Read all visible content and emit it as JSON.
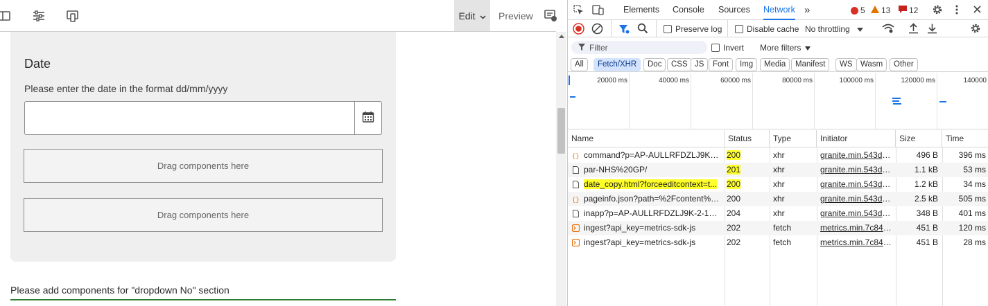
{
  "editor": {
    "toolbar": {
      "edit_label": "Edit",
      "preview_label": "Preview",
      "icons": [
        "sidebar-toggle-icon",
        "properties-icon",
        "emulator-icon",
        "annotations-panel-icon"
      ]
    },
    "date_component": {
      "title": "Date",
      "help_text": "Please enter the date in the format dd/mm/yyyy",
      "value": ""
    },
    "dropzones": [
      "Drag components here",
      "Drag components here"
    ],
    "section_note": "Please add components for \"dropdown No\" section"
  },
  "devtools": {
    "tabs": [
      "Elements",
      "Console",
      "Sources",
      "Network"
    ],
    "active_tab": "Network",
    "more_tabs": "»",
    "counts": {
      "errors": "5",
      "warnings": "13",
      "issues": "12"
    },
    "toolbar": {
      "preserve_log": "Preserve log",
      "disable_cache": "Disable cache",
      "throttling": "No throttling"
    },
    "filter": {
      "placeholder": "Filter",
      "invert": "Invert",
      "more_filters": "More filters"
    },
    "type_filters": [
      "All",
      "Fetch/XHR",
      "Doc",
      "CSS",
      "JS",
      "Font",
      "Img",
      "Media",
      "Manifest",
      "WS",
      "Wasm",
      "Other"
    ],
    "active_type": "Fetch/XHR",
    "timeline_labels": [
      "20000 ms",
      "40000 ms",
      "60000 ms",
      "80000 ms",
      "100000 ms",
      "120000 ms",
      "140000"
    ],
    "columns": [
      "Name",
      "Status",
      "Type",
      "Initiator",
      "Size",
      "Time"
    ],
    "requests": [
      {
        "name": "command?p=AP-AULLRFDZLJ9K-2-...",
        "status": "200",
        "type": "xhr",
        "initiator": "granite.min.543d214",
        "size": "496 B",
        "time": "396 ms",
        "icon": "json-icon",
        "highlight_status": true,
        "highlight_name": false
      },
      {
        "name": "par-NHS%20GP/",
        "status": "201",
        "type": "xhr",
        "initiator": "granite.min.543d214",
        "size": "1.1 kB",
        "time": "53 ms",
        "icon": "document-icon",
        "highlight_status": true,
        "highlight_name": false
      },
      {
        "name": "date_copy.html?forceeditcontext=t...",
        "status": "200",
        "type": "xhr",
        "initiator": "granite.min.543d214",
        "size": "1.2 kB",
        "time": "34 ms",
        "icon": "document-icon",
        "highlight_status": true,
        "highlight_name": true
      },
      {
        "name": "pageinfo.json?path=%2Fcontent%2...",
        "status": "200",
        "type": "xhr",
        "initiator": "granite.min.543d214",
        "size": "2.5 kB",
        "time": "505 ms",
        "icon": "json-icon",
        "highlight_status": false,
        "highlight_name": false
      },
      {
        "name": "inapp?p=AP-AULLRFDZLJ9K-2-1&s...",
        "status": "204",
        "type": "xhr",
        "initiator": "granite.min.543d214",
        "size": "348 B",
        "time": "401 ms",
        "icon": "document-icon",
        "highlight_status": false,
        "highlight_name": false
      },
      {
        "name": "ingest?api_key=metrics-sdk-js",
        "status": "202",
        "type": "fetch",
        "initiator": "metrics.min.7c843ba",
        "size": "451 B",
        "time": "120 ms",
        "icon": "fetch-icon",
        "highlight_status": false,
        "highlight_name": false
      },
      {
        "name": "ingest?api_key=metrics-sdk-js",
        "status": "202",
        "type": "fetch",
        "initiator": "metrics.min.7c843ba",
        "size": "451 B",
        "time": "28 ms",
        "icon": "fetch-icon",
        "highlight_status": false,
        "highlight_name": false
      }
    ]
  },
  "colors": {
    "accent": "#1a73e8",
    "highlight": "#ffff29",
    "error": "#d93025",
    "warning": "#e37400",
    "issue": "#c5221f",
    "section_line": "#2e7d32"
  }
}
